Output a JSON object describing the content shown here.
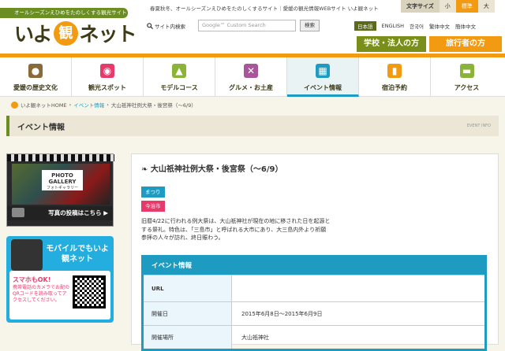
{
  "header": {
    "tagline": "オールシーズンえひめをたのしくする観光サイト",
    "logo_pre": "いよ",
    "logo_kanji": "観",
    "logo_post": "ネット",
    "description": "春夏秋冬、オールシーズンえひめをたのしくするサイト｜愛媛の観光情報WEBサイト いよ観ネット",
    "font_size_label": "文字サイズ",
    "font_sizes": [
      "小",
      "標準",
      "大"
    ],
    "search_label": "サイト内検索",
    "search_placeholder": "Google™ Custom Search",
    "search_button": "検索",
    "languages": [
      "日本語",
      "ENGLISH",
      "한국어",
      "繁体中文",
      "簡体中文"
    ],
    "btn_school": "学校・法人の方",
    "btn_traveler": "旅行者の方"
  },
  "nav": {
    "items": [
      {
        "label": "愛媛の歴史文化",
        "icon": "film-reel-icon",
        "color": "#8b6a3a"
      },
      {
        "label": "観光スポット",
        "icon": "camera-icon",
        "color": "#e8396b"
      },
      {
        "label": "モデルコース",
        "icon": "picture-icon",
        "color": "#8bb33a"
      },
      {
        "label": "グルメ・お土産",
        "icon": "fork-knife-icon",
        "color": "#a8559a"
      },
      {
        "label": "イベント情報",
        "icon": "calendar-icon",
        "color": "#1d9bc0"
      },
      {
        "label": "宿泊予約",
        "icon": "hotel-icon",
        "color": "#f19a12"
      },
      {
        "label": "アクセス",
        "icon": "car-icon",
        "color": "#8bb33a"
      }
    ]
  },
  "breadcrumb": {
    "home": "いよ観ネットHOME",
    "sep": "›",
    "section": "イベント情報",
    "current": "大山祇神社例大祭・後宮祭（～6/9）"
  },
  "page_title": {
    "title": "イベント情報",
    "en": "EVENT INFO"
  },
  "sidebar": {
    "gallery_title": "PHOTO GALLERY",
    "gallery_sub": "フォトギャラリー",
    "photo_post": "写真の投稿はこちら ▶",
    "mobile_title": "モバイルでもいよ観ネット",
    "sumaho": "スマホもOK!",
    "qr_desc": "携帯電話のカメラでお配のQRコードを読み取ってアクセスしてください。"
  },
  "event": {
    "title": "大山祇神社例大祭・後宮祭（～6/9）",
    "tags": [
      "まつり",
      "今治市"
    ],
    "description": "旧暦4/22に行われる例大祭は、大山祇神社が現在の地に移された日を起源とする祭礼。特色は、「三島市」と呼ばれる大市にあり、大三島内外より祈願参拝の人々が訪れ、終日賑わう。",
    "info_header": "イベント情報",
    "rows": [
      {
        "key": "URL",
        "value": ""
      },
      {
        "key": "開催日",
        "value": "2015年6月8日～2015年6月9日"
      },
      {
        "key": "開催場所",
        "value": "大山祇神社"
      }
    ]
  }
}
